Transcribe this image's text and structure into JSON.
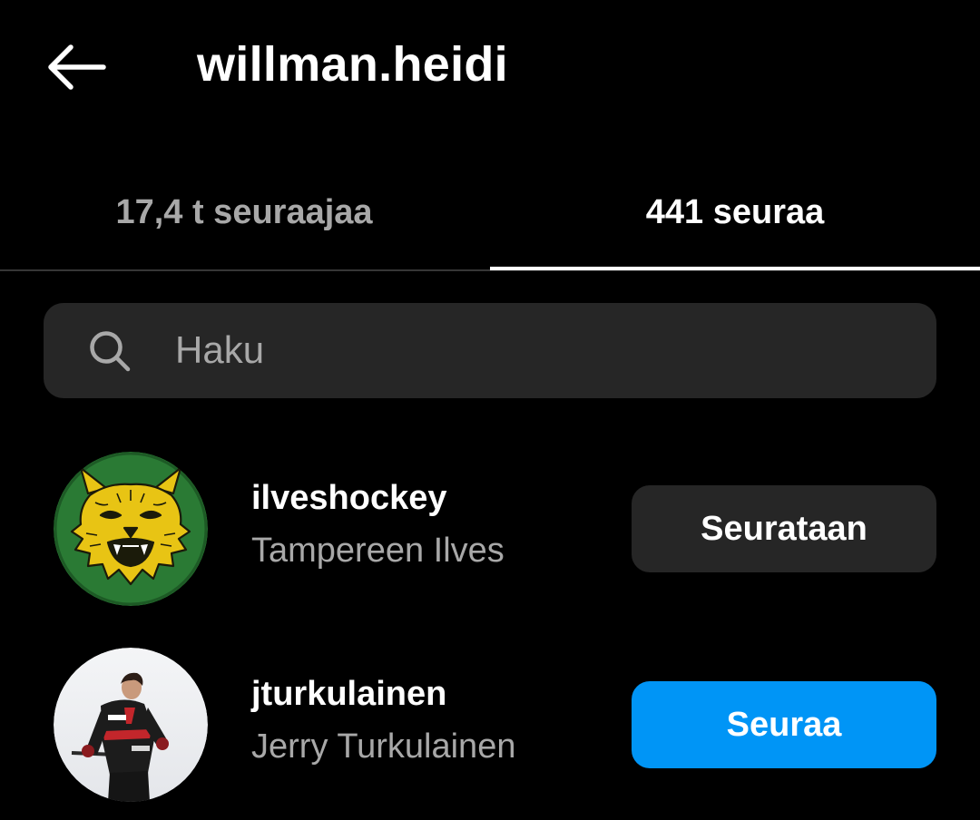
{
  "header": {
    "title": "willman.heidi",
    "back_icon": "arrow-left-icon"
  },
  "tabs": [
    {
      "label": "17,4 t seuraajaa",
      "active": false
    },
    {
      "label": "441 seuraa",
      "active": true
    }
  ],
  "search": {
    "placeholder": "Haku",
    "value": "",
    "icon": "search-icon"
  },
  "users": [
    {
      "username": "ilveshockey",
      "fullname": "Tampereen Ilves",
      "button_label": "Seurataan",
      "button_color": "#262626",
      "avatar": "lynx-logo"
    },
    {
      "username": "jturkulainen",
      "fullname": "Jerry Turkulainen",
      "button_label": "Seuraa",
      "button_color": "#0095f6",
      "avatar": "hockey-player-photo"
    }
  ],
  "colors": {
    "background": "#000000",
    "primary_text": "#ffffff",
    "secondary_text": "#a8a8a8",
    "surface": "#262626",
    "accent": "#0095f6"
  }
}
